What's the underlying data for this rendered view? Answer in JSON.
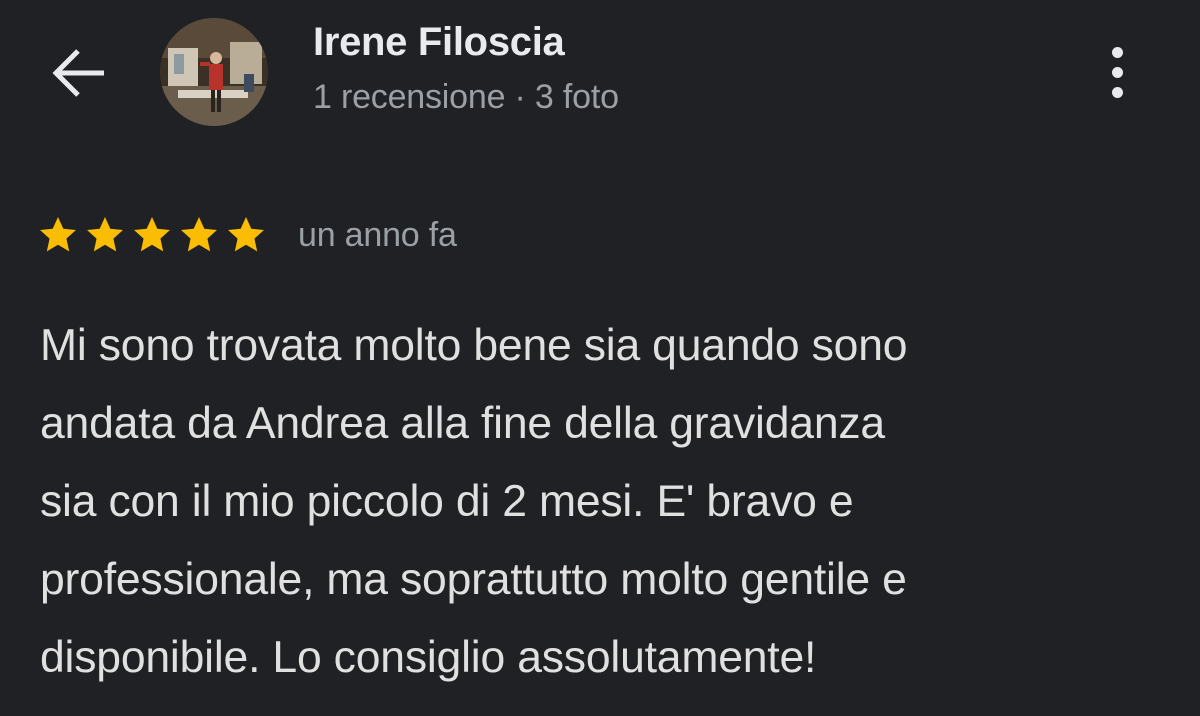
{
  "header": {
    "back_icon": "arrow-back-icon",
    "more_icon": "more-vert-icon",
    "user": {
      "name": "Irene Filoscia",
      "review_count": "1 recensione",
      "separator": "·",
      "photo_count": "3 foto"
    }
  },
  "review": {
    "rating": 5,
    "rating_max": 5,
    "star_color": "#fbbc04",
    "date": "un anno fa",
    "text_lines": [
      "Mi sono trovata molto bene sia quando sono",
      "andata da Andrea alla fine della gravidanza",
      "sia con il mio piccolo di 2 mesi. E' bravo e",
      "professionale, ma soprattutto molto gentile e",
      "disponibile. Lo consiglio assolutamente!"
    ]
  },
  "colors": {
    "background": "#202124",
    "primary_text": "#e8eaed",
    "secondary_text": "#9aa0a6"
  }
}
